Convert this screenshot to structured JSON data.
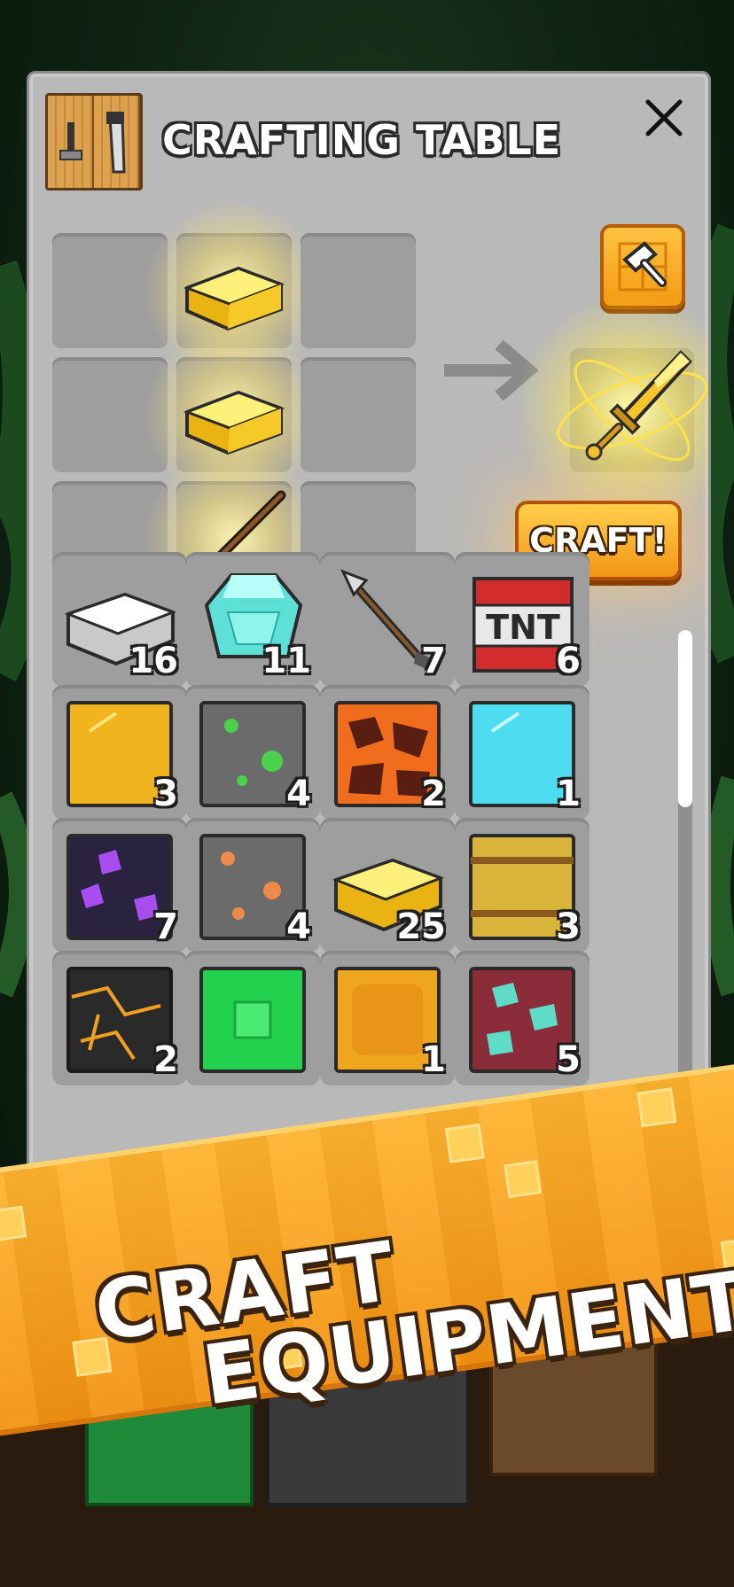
{
  "header": {
    "title": "CRAFTING TABLE",
    "icon": "crafting-table-icon",
    "close_icon": "close-icon"
  },
  "crafting_grid": {
    "slots": [
      {
        "item": "empty"
      },
      {
        "item": "gold-ingot",
        "highlighted": true
      },
      {
        "item": "empty"
      },
      {
        "item": "empty"
      },
      {
        "item": "gold-ingot",
        "highlighted": true
      },
      {
        "item": "empty"
      },
      {
        "item": "empty"
      },
      {
        "item": "stick",
        "highlighted": true
      },
      {
        "item": "empty"
      }
    ],
    "arrow_icon": "arrow-right-icon",
    "result": {
      "item": "gold-sword",
      "glowing": true
    },
    "tool_button_icon": "hammer-icon",
    "craft_button_label": "CRAFT!"
  },
  "inventory": {
    "items": [
      {
        "name": "iron-ingot",
        "count": "16"
      },
      {
        "name": "diamond-gem",
        "count": "11"
      },
      {
        "name": "arrow",
        "count": "7"
      },
      {
        "name": "tnt",
        "count": "6",
        "label": "TNT"
      },
      {
        "name": "gold-block",
        "count": "3"
      },
      {
        "name": "emerald-ore",
        "count": "4"
      },
      {
        "name": "magma-block",
        "count": "2"
      },
      {
        "name": "diamond-block",
        "count": "1"
      },
      {
        "name": "amethyst-ore",
        "count": "7"
      },
      {
        "name": "copper-ore",
        "count": "4"
      },
      {
        "name": "gold-ingot",
        "count": "25"
      },
      {
        "name": "hay-bale",
        "count": "3"
      },
      {
        "name": "lava-stone",
        "count": "2"
      },
      {
        "name": "emerald-block",
        "count": ""
      },
      {
        "name": "honey-block",
        "count": "1"
      },
      {
        "name": "diamond-ore",
        "count": "5"
      }
    ]
  },
  "banner": {
    "line1": "CRAFT",
    "line2": "EQUIPMENT"
  },
  "colors": {
    "panel": "#b9b9b9",
    "slot": "#9e9e9e",
    "orange_button": "#f39a12",
    "banner_orange": "#ffb32e",
    "text_outline": "#2a2a2a"
  }
}
